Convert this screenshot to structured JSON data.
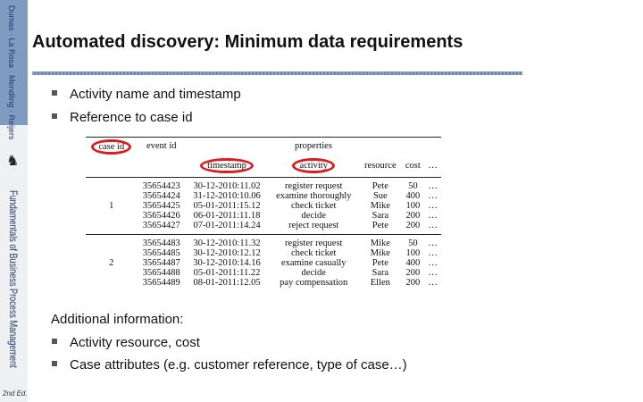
{
  "sidebar": {
    "authors": "Dumas · La Rosa · Mendling · Reijers",
    "book": "Fundamentals of Business Process Management",
    "edition": "2nd Ed."
  },
  "slide": {
    "title": "Automated discovery: Minimum data requirements",
    "bullets1": [
      "Activity name and timestamp",
      "Reference to case id"
    ],
    "additional": "Additional information:",
    "bullets2": [
      "Activity resource, cost",
      "Case attributes (e.g. customer reference, type of case…)"
    ]
  },
  "table": {
    "headers": {
      "case_id": "case id",
      "event_id": "event id",
      "properties": "properties",
      "timestamp": "timestamp",
      "activity": "activity",
      "resource": "resource",
      "cost": "cost",
      "more": "…"
    },
    "cases": [
      {
        "id": "1",
        "events": [
          [
            "35654423",
            "30-12-2010:11.02",
            "register request",
            "Pete",
            "50",
            "…"
          ],
          [
            "35654424",
            "31-12-2010:10.06",
            "examine thoroughly",
            "Sue",
            "400",
            "…"
          ],
          [
            "35654425",
            "05-01-2011:15.12",
            "check ticket",
            "Mike",
            "100",
            "…"
          ],
          [
            "35654426",
            "06-01-2011:11.18",
            "decide",
            "Sara",
            "200",
            "…"
          ],
          [
            "35654427",
            "07-01-2011:14.24",
            "reject request",
            "Pete",
            "200",
            "…"
          ]
        ]
      },
      {
        "id": "2",
        "events": [
          [
            "35654483",
            "30-12-2010:11.32",
            "register request",
            "Mike",
            "50",
            "…"
          ],
          [
            "35654485",
            "30-12-2010:12.12",
            "check ticket",
            "Mike",
            "100",
            "…"
          ],
          [
            "35654487",
            "30-12-2010:14.16",
            "examine casually",
            "Pete",
            "400",
            "…"
          ],
          [
            "35654488",
            "05-01-2011:11.22",
            "decide",
            "Sara",
            "200",
            "…"
          ],
          [
            "35654489",
            "08-01-2011:12.05",
            "pay compensation",
            "Ellen",
            "200",
            "…"
          ]
        ]
      }
    ]
  },
  "colors": {
    "highlight": "#d81e1e",
    "sidebar": "#7f9bbf"
  }
}
